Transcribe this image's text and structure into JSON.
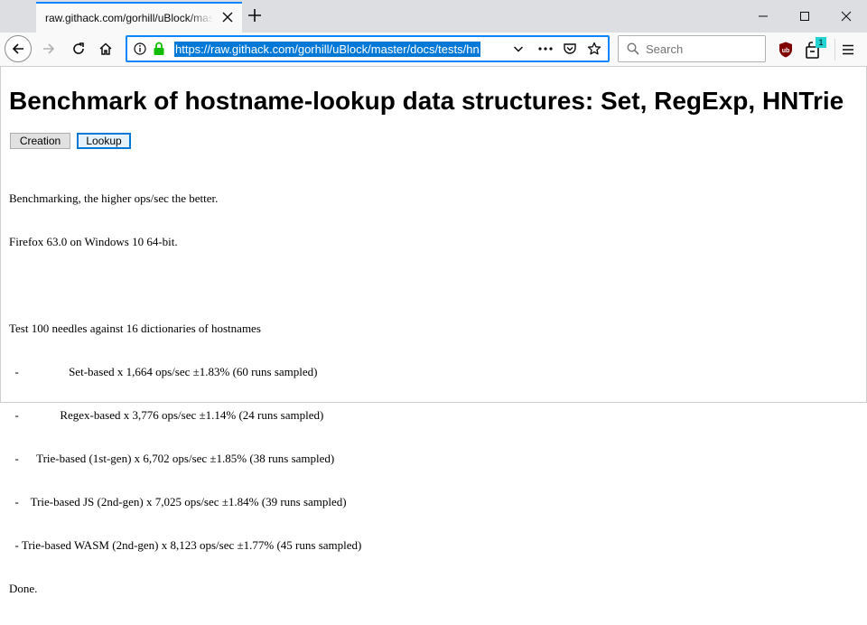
{
  "tab": {
    "title": "raw.githack.com/gorhill/uBlock/master/docs/tests/hntrie-test.html"
  },
  "urlbar": {
    "url": "https://raw.githack.com/gorhill/uBlock/master/docs/tests/hn"
  },
  "search": {
    "placeholder": "Search"
  },
  "extensions": {
    "badge_count": "1"
  },
  "page": {
    "title": "Benchmark of hostname-lookup data structures: Set, RegExp, HNTrie",
    "buttons": {
      "creation": "Creation",
      "lookup": "Lookup"
    },
    "output_lines": [
      "Benchmarking, the higher ops/sec the better.",
      "Firefox 63.0 on Windows 10 64-bit.",
      "",
      "Test 100 needles against 16 dictionaries of hostnames",
      "  -                 Set-based x 1,664 ops/sec ±1.83% (60 runs sampled)",
      "  -              Regex-based x 3,776 ops/sec ±1.14% (24 runs sampled)",
      "  -      Trie-based (1st-gen) x 6,702 ops/sec ±1.85% (38 runs sampled)",
      "  -    Trie-based JS (2nd-gen) x 7,025 ops/sec ±1.84% (39 runs sampled)",
      "  - Trie-based WASM (2nd-gen) x 8,123 ops/sec ±1.77% (45 runs sampled)",
      "Done."
    ]
  },
  "colors": {
    "accent": "#0a84ff",
    "url_selection": "#0078d7",
    "ublock_red": "#800000",
    "badge_cyan": "#22d3d3"
  }
}
